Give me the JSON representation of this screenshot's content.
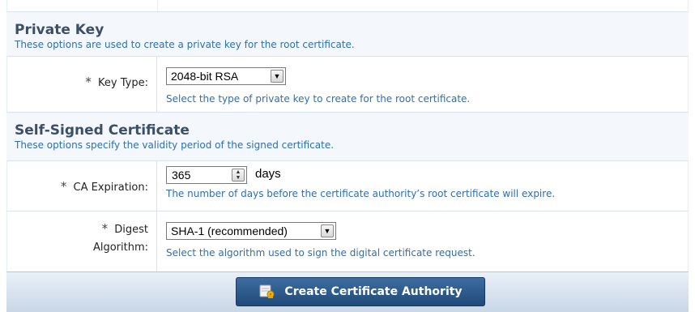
{
  "private_key": {
    "title": "Private Key",
    "description": "These options are used to create a private key for the root certificate.",
    "key_type": {
      "required_marker": "*",
      "label": "Key Type:",
      "value": "2048-bit RSA",
      "help": "Select the type of private key to create for the root certificate."
    }
  },
  "self_signed": {
    "title": "Self-Signed Certificate",
    "description": "These options specify the validity period of the signed certificate.",
    "ca_expiration": {
      "required_marker": "*",
      "label": "CA Expiration:",
      "value": "365",
      "unit": "days",
      "help": "The number of days before the certificate authority’s root certificate will expire."
    },
    "digest": {
      "required_marker": "*",
      "label_line1": "Digest",
      "label_line2": "Algorithm:",
      "value": "SHA-1 (recommended)",
      "help": "Select the algorithm used to sign the digital certificate request."
    }
  },
  "footer": {
    "create_button_label": "Create Certificate Authority",
    "create_button_icon": "certificate-key-icon"
  },
  "colors": {
    "section_title": "#3b4f66",
    "help_text": "#2e6fb0",
    "button_bg": "#2a5688"
  }
}
